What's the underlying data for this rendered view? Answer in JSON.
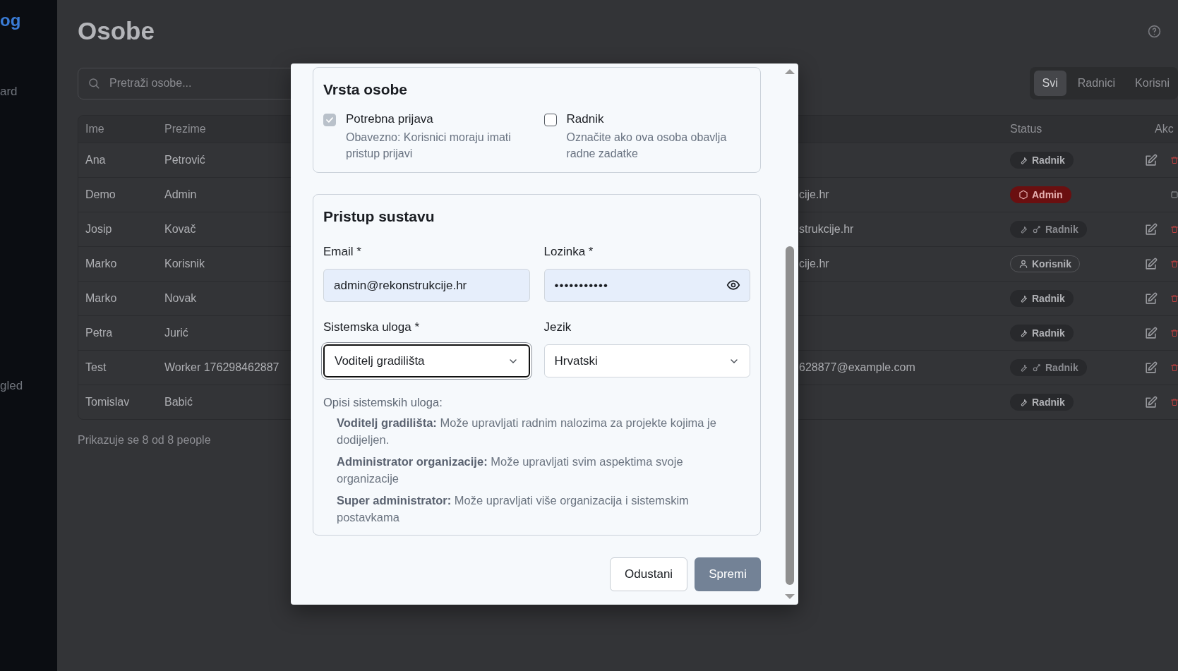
{
  "sidebar": {
    "brand": "og",
    "items": [
      {
        "label": "ard"
      },
      {
        "label": "gled"
      }
    ]
  },
  "page": {
    "title": "Osobe"
  },
  "search": {
    "placeholder": "Pretraži osobe..."
  },
  "filter_tabs": [
    {
      "label": "Svi",
      "selected": true
    },
    {
      "label": "Radnici",
      "selected": false
    },
    {
      "label": "Korisni",
      "selected": false
    }
  ],
  "table": {
    "columns": [
      "Ime",
      "Prezime",
      "Status",
      "Akc"
    ],
    "rows": [
      {
        "first_name": "Ana",
        "last_name": "Petrović",
        "status": {
          "kind": "radnik",
          "label": "Radnik"
        },
        "editable": true
      },
      {
        "first_name": "Demo",
        "last_name": "Admin",
        "email": "cije.hr",
        "status": {
          "kind": "admin",
          "label": "Admin"
        },
        "editable": false
      },
      {
        "first_name": "Josip",
        "last_name": "Kovač",
        "email": "strukcije.hr",
        "status": {
          "kind": "radnik_key",
          "label": "Radnik"
        },
        "editable": true
      },
      {
        "first_name": "Marko",
        "last_name": "Korisnik",
        "email": "cije.hr",
        "status": {
          "kind": "korisnik",
          "label": "Korisnik"
        },
        "editable": true
      },
      {
        "first_name": "Marko",
        "last_name": "Novak",
        "status": {
          "kind": "radnik",
          "label": "Radnik"
        },
        "editable": true
      },
      {
        "first_name": "Petra",
        "last_name": "Jurić",
        "status": {
          "kind": "radnik",
          "label": "Radnik"
        },
        "editable": true
      },
      {
        "first_name": "Test",
        "last_name": "Worker 176298462887",
        "email": "628877@example.com",
        "status": {
          "kind": "radnik_key",
          "label": "Radnik"
        },
        "editable": true
      },
      {
        "first_name": "Tomislav",
        "last_name": "Babić",
        "status": {
          "kind": "radnik",
          "label": "Radnik"
        },
        "editable": true
      }
    ]
  },
  "footer": "Prikazuje se 8 od 8 people",
  "dialog": {
    "person_type": {
      "title": "Vrsta osobe",
      "options": [
        {
          "label": "Potrebna prijava",
          "description": "Obavezno: Korisnici moraju imati pristup prijavi",
          "checked": true,
          "disabled": true
        },
        {
          "label": "Radnik",
          "description": "Označite ako ova osoba obavlja radne zadatke",
          "checked": false,
          "disabled": false
        }
      ]
    },
    "system_access": {
      "title": "Pristup sustavu",
      "fields": [
        {
          "kind": "text",
          "label": "Email *",
          "value": "admin@rekonstrukcije.hr",
          "focused": false
        },
        {
          "kind": "password",
          "label": "Lozinka *",
          "value": "•••••••••••",
          "focused": false
        },
        {
          "kind": "select",
          "label": "Sistemska uloga *",
          "value": "Voditelj gradilišta",
          "focused": true
        },
        {
          "kind": "select",
          "label": "Jezik",
          "value": "Hrvatski",
          "focused": false
        }
      ],
      "roles_heading": "Opisi sistemskih uloga:",
      "role_descriptions": [
        "**Voditelj gradilišta:** Može upravljati radnim nalozima za projekte kojima je dodijeljen.",
        "**Administrator organizacije:** Može upravljati svim aspektima svoje organizacije",
        "**Super administrator:** Može upravljati više organizacija i sistemskim postavkama"
      ]
    },
    "buttons": [
      {
        "label": "Odustani",
        "kind": "secondary"
      },
      {
        "label": "Spremi",
        "kind": "primary"
      }
    ]
  }
}
